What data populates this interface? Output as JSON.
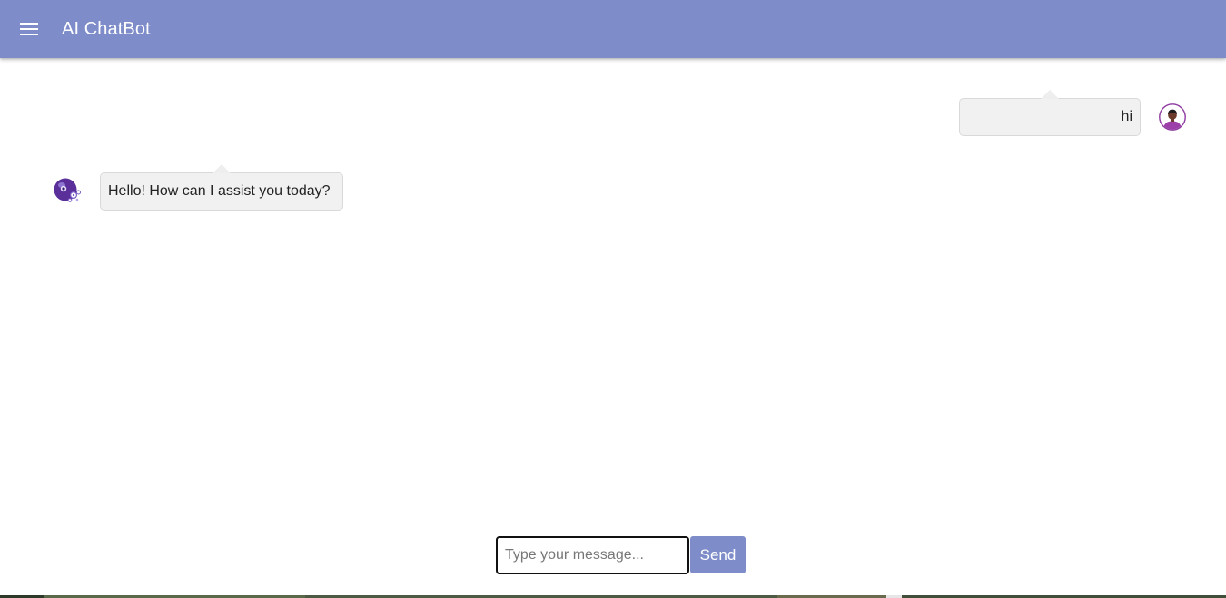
{
  "header": {
    "title": "AI ChatBot",
    "menu_icon": "hamburger-menu-icon"
  },
  "colors": {
    "accent": "#7e8cc9",
    "bubble_bg": "#f1f1f1",
    "bubble_border": "#d9d9d9",
    "user_avatar": "#8e3aa0",
    "bot_avatar": "#5a2f9a"
  },
  "messages": [
    {
      "sender": "user",
      "text": "hi",
      "avatar_icon": "user-avatar-icon"
    },
    {
      "sender": "bot",
      "text": "Hello! How can I assist you today?",
      "avatar_icon": "robot-avatar-icon"
    }
  ],
  "composer": {
    "value": "",
    "placeholder": "Type your message...",
    "send_label": "Send"
  }
}
